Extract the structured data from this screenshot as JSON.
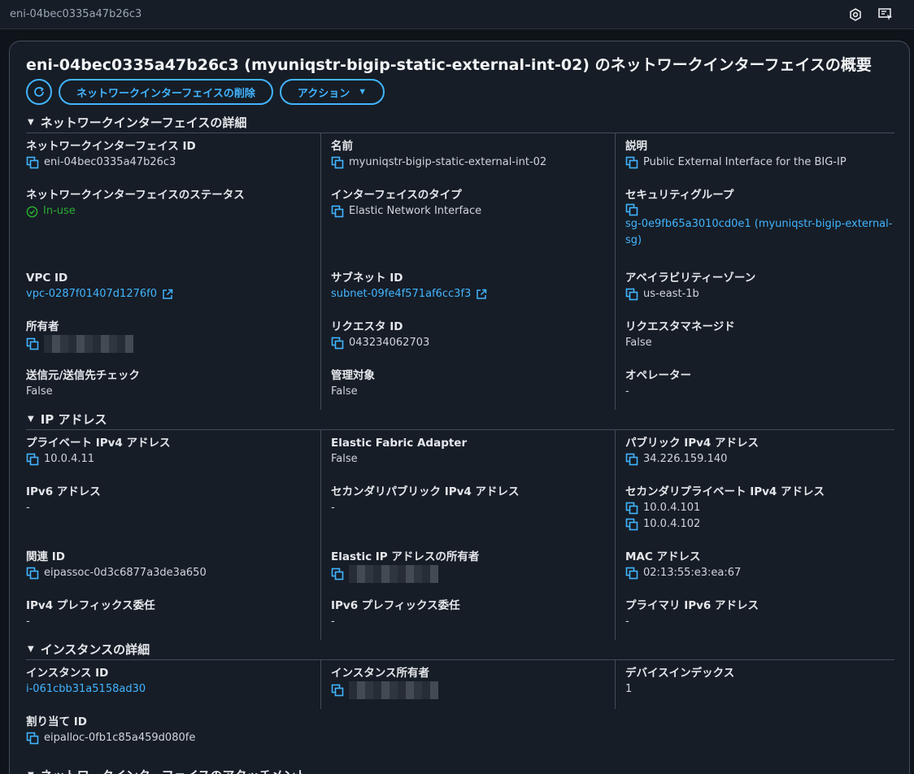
{
  "topbar": {
    "crumb": "eni-04bec0335a47b26c3",
    "icons": [
      "settings-hex-icon",
      "screen-cursor-icon"
    ]
  },
  "page": {
    "title": "eni-04bec0335a47b26c3 (myuniqstr-bigip-static-external-int-02) のネットワークインターフェイスの概要",
    "buttons": {
      "delete": "ネットワークインターフェイスの削除",
      "actions": "アクション"
    }
  },
  "sections": {
    "details": {
      "title": "ネットワークインターフェイスの詳細",
      "eni_id_label": "ネットワークインターフェイス ID",
      "eni_id": "eni-04bec0335a47b26c3",
      "name_label": "名前",
      "name": "myuniqstr-bigip-static-external-int-02",
      "desc_label": "説明",
      "desc": "Public External Interface for the BIG-IP",
      "status_label": "ネットワークインターフェイスのステータス",
      "status": "In-use",
      "iftype_label": "インターフェイスのタイプ",
      "iftype": "Elastic Network Interface",
      "sg_label": "セキュリティグループ",
      "sg_line1": "sg-0e9fb65a3010cd0e1 (myuniqstr-bigip-external-",
      "sg_line2": "sg)",
      "vpc_label": "VPC ID",
      "vpc": "vpc-0287f01407d1276f0",
      "subnet_label": "サブネット ID",
      "subnet": "subnet-09fe4f571af6cc3f3",
      "az_label": "アベイラビリティーゾーン",
      "az": "us-east-1b",
      "owner_label": "所有者",
      "requester_label": "リクエスタ ID",
      "requester": "043234062703",
      "req_managed_label": "リクエスタマネージド",
      "req_managed": "False",
      "srcdst_label": "送信元/送信先チェック",
      "srcdst": "False",
      "managed_label": "管理対象",
      "managed": "False",
      "operator_label": "オペレーター",
      "operator": "-"
    },
    "ip": {
      "title": "IP アドレス",
      "priv4_label": "プライベート IPv4 アドレス",
      "priv4": "10.0.4.11",
      "efa_label": "Elastic Fabric Adapter",
      "efa": "False",
      "pub4_label": "パブリック IPv4 アドレス",
      "pub4": "34.226.159.140",
      "ipv6_label": "IPv6 アドレス",
      "ipv6": "-",
      "sec_pub4_label": "セカンダリパブリック IPv4 アドレス",
      "sec_pub4": "-",
      "sec_priv4_label": "セカンダリプライベート IPv4 アドレス",
      "sec_priv4_1": "10.0.4.101",
      "sec_priv4_2": "10.0.4.102",
      "assoc_label": "関連 ID",
      "assoc": "eipassoc-0d3c6877a3de3a650",
      "eip_owner_label": "Elastic IP アドレスの所有者",
      "mac_label": "MAC アドレス",
      "mac": "02:13:55:e3:ea:67",
      "ipv4pfx_label": "IPv4 プレフィックス委任",
      "ipv4pfx": "-",
      "ipv6pfx_label": "IPv6 プレフィックス委任",
      "ipv6pfx": "-",
      "prim6_label": "プライマリ IPv6 アドレス",
      "prim6": "-"
    },
    "instance": {
      "title": "インスタンスの詳細",
      "inst_id_label": "インスタンス ID",
      "inst_id": "i-061cbb31a5158ad30",
      "inst_owner_label": "インスタンス所有者",
      "dev_idx_label": "デバイスインデックス",
      "dev_idx": "1",
      "alloc_label": "割り当て ID",
      "alloc": "eipalloc-0fb1c85a459d080fe"
    },
    "attachment": {
      "title": "ネットワークインターフェイスのアタッチメント"
    }
  },
  "colors": {
    "link": "#42b4ff",
    "ok": "#29ad32",
    "bg": "#0f141a",
    "panel": "#161d26"
  }
}
